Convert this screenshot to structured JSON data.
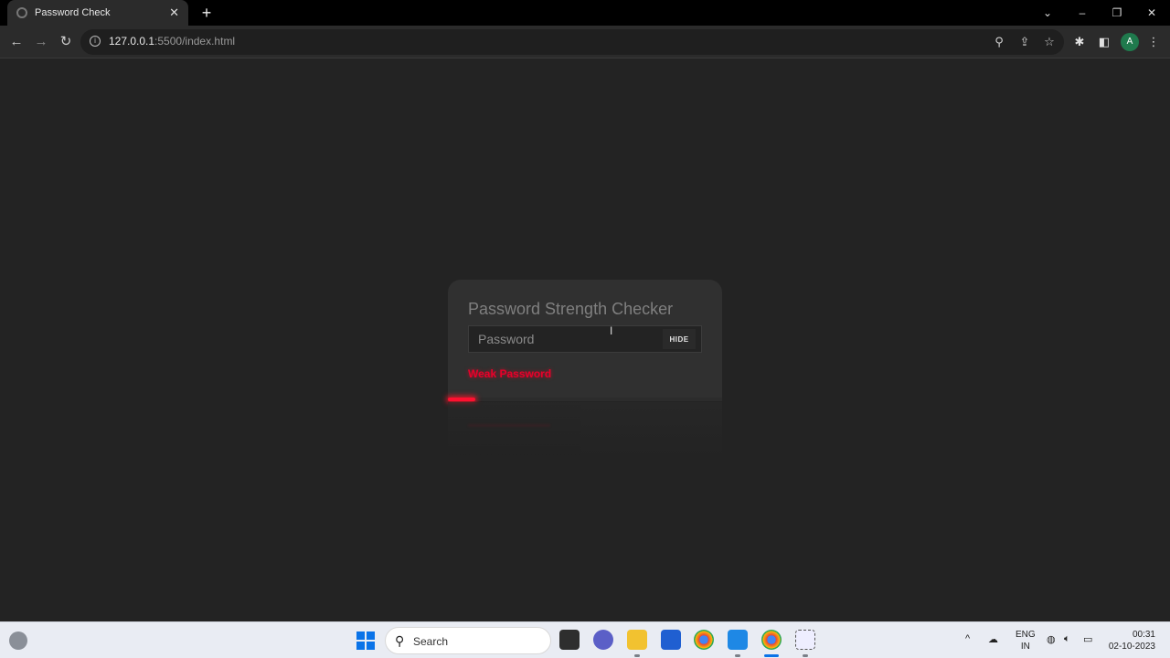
{
  "browser": {
    "tab_title": "Password Check",
    "url_host": "127.0.0.1",
    "url_rest": ":5500/index.html",
    "profile_initial": "A"
  },
  "app": {
    "title": "Password Strength Checker",
    "password_placeholder": "Password",
    "password_value": "",
    "hide_label": "HIDE",
    "strength_label": "Weak Password",
    "strength_fraction": 0.1,
    "strength_color": "#ff1030"
  },
  "taskbar": {
    "search_label": "Search",
    "lang_line1": "ENG",
    "lang_line2": "IN",
    "time": "00:31",
    "date": "02-10-2023"
  }
}
